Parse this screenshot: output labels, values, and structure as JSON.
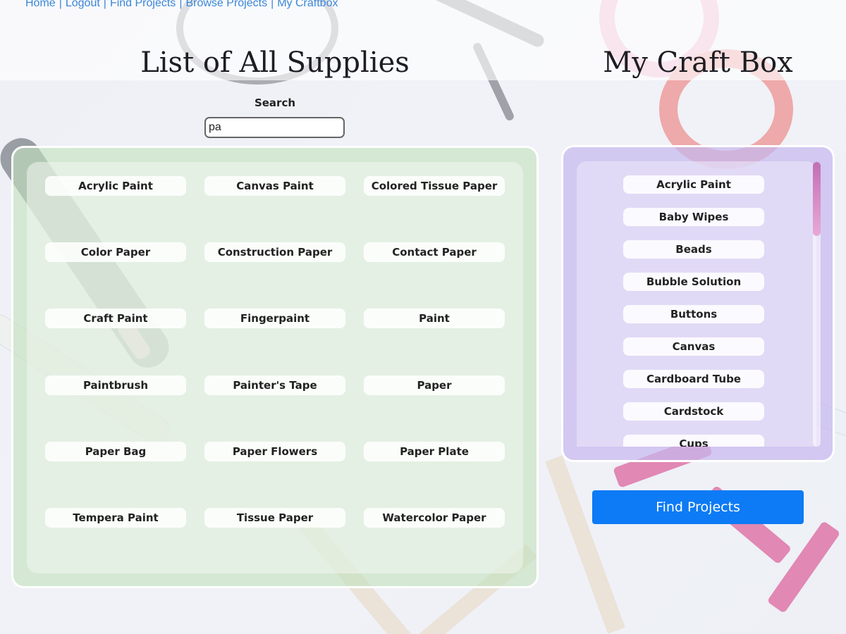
{
  "nav": {
    "links": [
      "Home",
      "Logout",
      "Find Projects",
      "Browse Projects",
      "My Craftbox"
    ],
    "separator": "|"
  },
  "headings": {
    "all_supplies": "List of All Supplies",
    "craft_box": "My Craft Box"
  },
  "search": {
    "label": "Search",
    "value": "pa"
  },
  "supplies": [
    "Acrylic Paint",
    "Canvas Paint",
    "Colored Tissue Paper",
    "Color Paper",
    "Construction Paper",
    "Contact Paper",
    "Craft Paint",
    "Fingerpaint",
    "Paint",
    "Paintbrush",
    "Painter's Tape",
    "Paper",
    "Paper Bag",
    "Paper Flowers",
    "Paper Plate",
    "Tempera Paint",
    "Tissue Paper",
    "Watercolor Paper"
  ],
  "craft_box": {
    "items": [
      "Acrylic Paint",
      "Baby Wipes",
      "Beads",
      "Bubble Solution",
      "Buttons",
      "Canvas",
      "Cardboard Tube",
      "Cardstock",
      "Cups"
    ],
    "scroll_position": 0
  },
  "actions": {
    "find_projects": "Find Projects"
  },
  "colors": {
    "nav_link": "#3b86d6",
    "primary_button": "#0d7bf5",
    "left_panel": "#c4e2be",
    "right_panel": "#c6b8ee",
    "scroll_thumb": "#d58bc6"
  }
}
